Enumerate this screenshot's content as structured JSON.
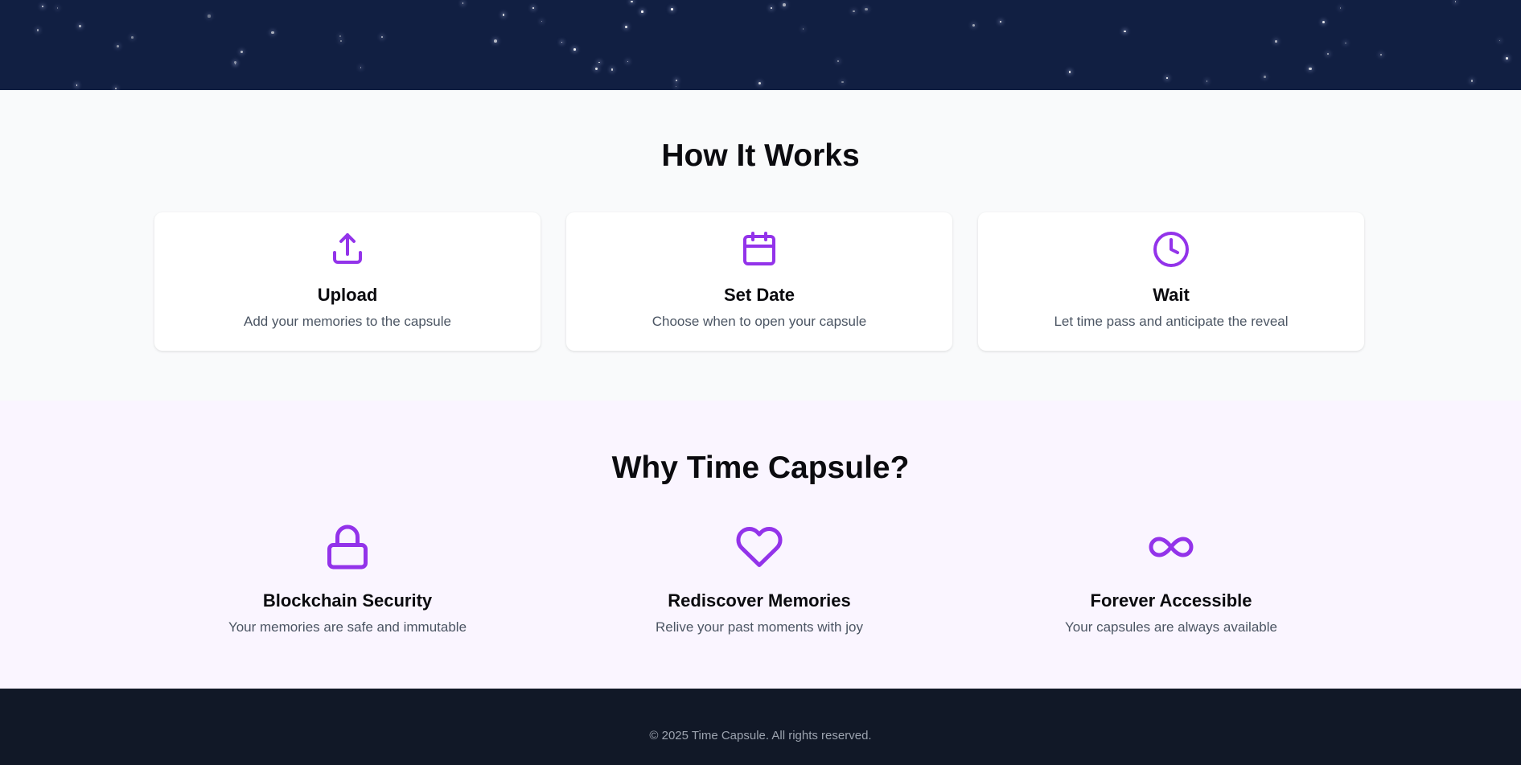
{
  "colors": {
    "accent": "#9333ea",
    "hero_bg": "#111f42",
    "footer_bg": "#111827"
  },
  "how": {
    "title": "How It Works",
    "steps": [
      {
        "icon": "upload-icon",
        "title": "Upload",
        "desc": "Add your memories to the capsule"
      },
      {
        "icon": "calendar-icon",
        "title": "Set Date",
        "desc": "Choose when to open your capsule"
      },
      {
        "icon": "clock-icon",
        "title": "Wait",
        "desc": "Let time pass and anticipate the reveal"
      }
    ]
  },
  "why": {
    "title": "Why Time Capsule?",
    "features": [
      {
        "icon": "lock-icon",
        "title": "Blockchain Security",
        "desc": "Your memories are safe and immutable"
      },
      {
        "icon": "heart-icon",
        "title": "Rediscover Memories",
        "desc": "Relive your past moments with joy"
      },
      {
        "icon": "infinity-icon",
        "title": "Forever Accessible",
        "desc": "Your capsules are always available"
      }
    ]
  },
  "footer": {
    "text": "© 2025 Time Capsule. All rights reserved."
  }
}
